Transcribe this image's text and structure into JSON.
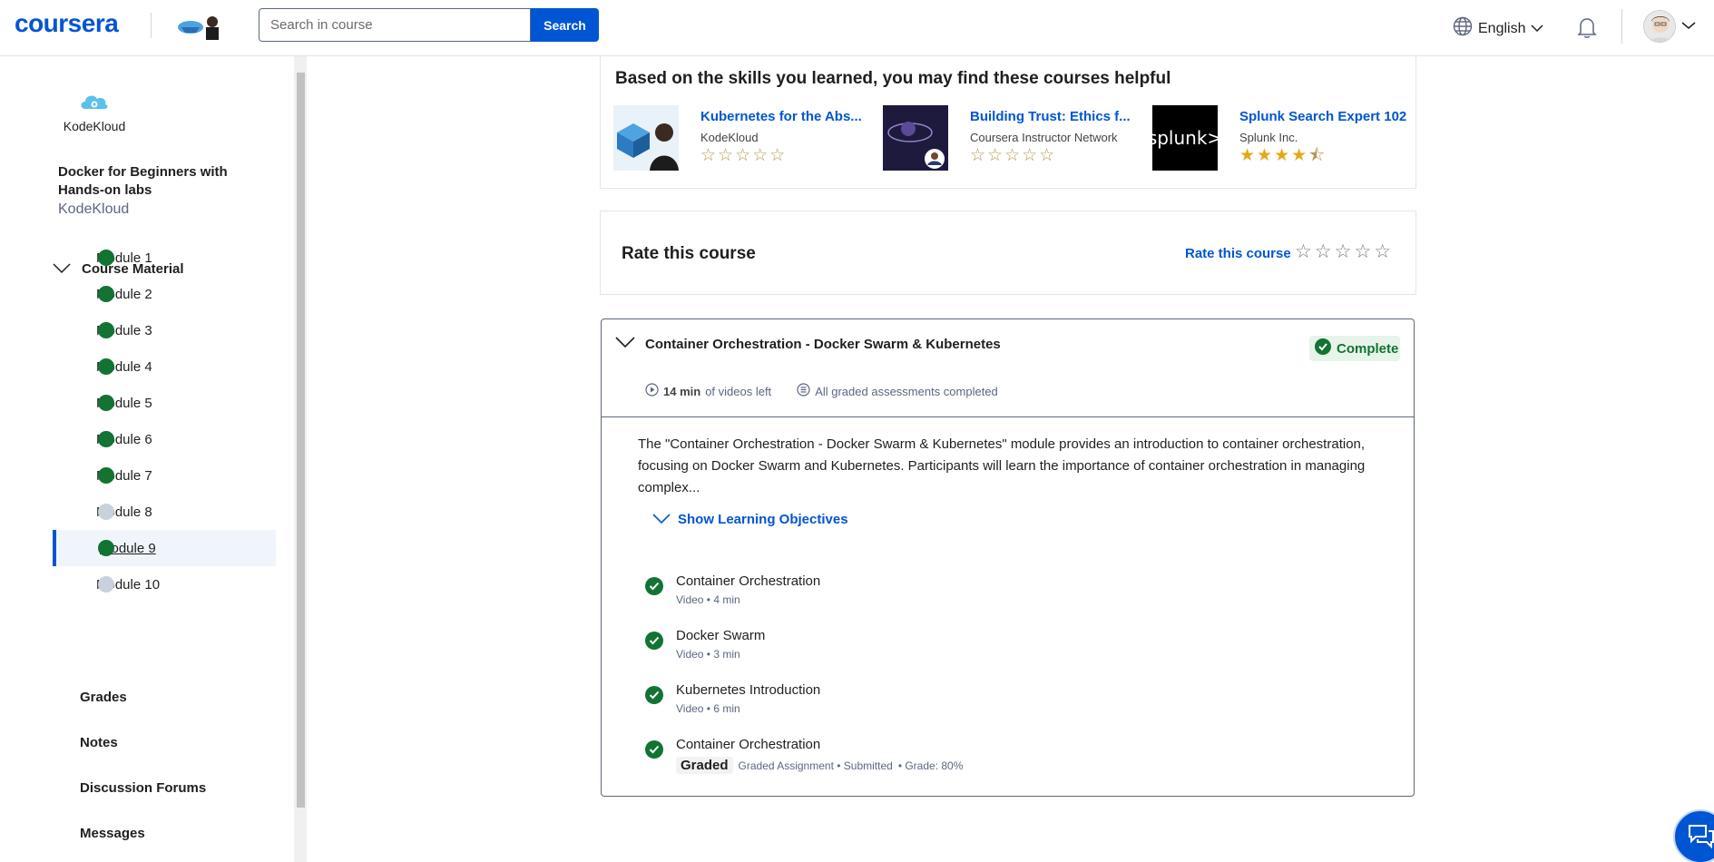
{
  "header": {
    "logo": "coursera",
    "search_placeholder": "Search in course",
    "search_button": "Search",
    "language": "English"
  },
  "sidebar": {
    "partner_name": "KodeKloud",
    "course_title": "Docker for Beginners with Hands-on labs",
    "course_org": "KodeKloud",
    "course_material_label": "Course Material",
    "modules": [
      {
        "label": "Module 1",
        "status": "complete"
      },
      {
        "label": "Module 2",
        "status": "complete"
      },
      {
        "label": "Module 3",
        "status": "complete"
      },
      {
        "label": "Module 4",
        "status": "complete"
      },
      {
        "label": "Module 5",
        "status": "complete"
      },
      {
        "label": "Module 6",
        "status": "complete"
      },
      {
        "label": "Module 7",
        "status": "complete"
      },
      {
        "label": "Module 8",
        "status": "incomplete"
      },
      {
        "label": "Module 9",
        "status": "complete",
        "active": true
      },
      {
        "label": "Module 10",
        "status": "incomplete"
      }
    ],
    "links": [
      "Grades",
      "Notes",
      "Discussion Forums",
      "Messages"
    ]
  },
  "recommendations": {
    "heading": "Based on the skills you learned, you may find these courses helpful",
    "items": [
      {
        "title": "Kubernetes for the Abs...",
        "org": "KodeKloud",
        "rating": 0
      },
      {
        "title": "Building Trust: Ethics f...",
        "org": "Coursera Instructor Network",
        "rating": 0
      },
      {
        "title": "Splunk Search Expert 102",
        "org": "Splunk Inc.",
        "rating": 4.5,
        "logo_text": "splunk>"
      }
    ]
  },
  "rate": {
    "title": "Rate this course",
    "link": "Rate this course"
  },
  "module": {
    "title": "Container Orchestration - Docker Swarm & Kubernetes",
    "status": "Complete",
    "videos_left_time": "14 min",
    "videos_left_suffix": "of videos left",
    "assessments": "All graded assessments completed",
    "description": "The \"Container Orchestration - Docker Swarm & Kubernetes\" module provides an introduction to container orchestration, focusing on Docker Swarm and Kubernetes. Participants will learn the importance of container orchestration in managing complex...",
    "objectives_link": "Show Learning Objectives",
    "items": [
      {
        "title": "Container Orchestration",
        "meta": "Video • 4 min"
      },
      {
        "title": "Docker Swarm",
        "meta": "Video • 3 min"
      },
      {
        "title": "Kubernetes Introduction",
        "meta": "Video • 6 min"
      },
      {
        "title": "Container Orchestration",
        "tag": "Graded",
        "meta": "Graded Assignment • Submitted",
        "grade": "• Grade: 80%"
      }
    ]
  },
  "colors": {
    "brand": "#0056d2",
    "complete": "#137333",
    "incomplete": "#c9d1dd"
  }
}
